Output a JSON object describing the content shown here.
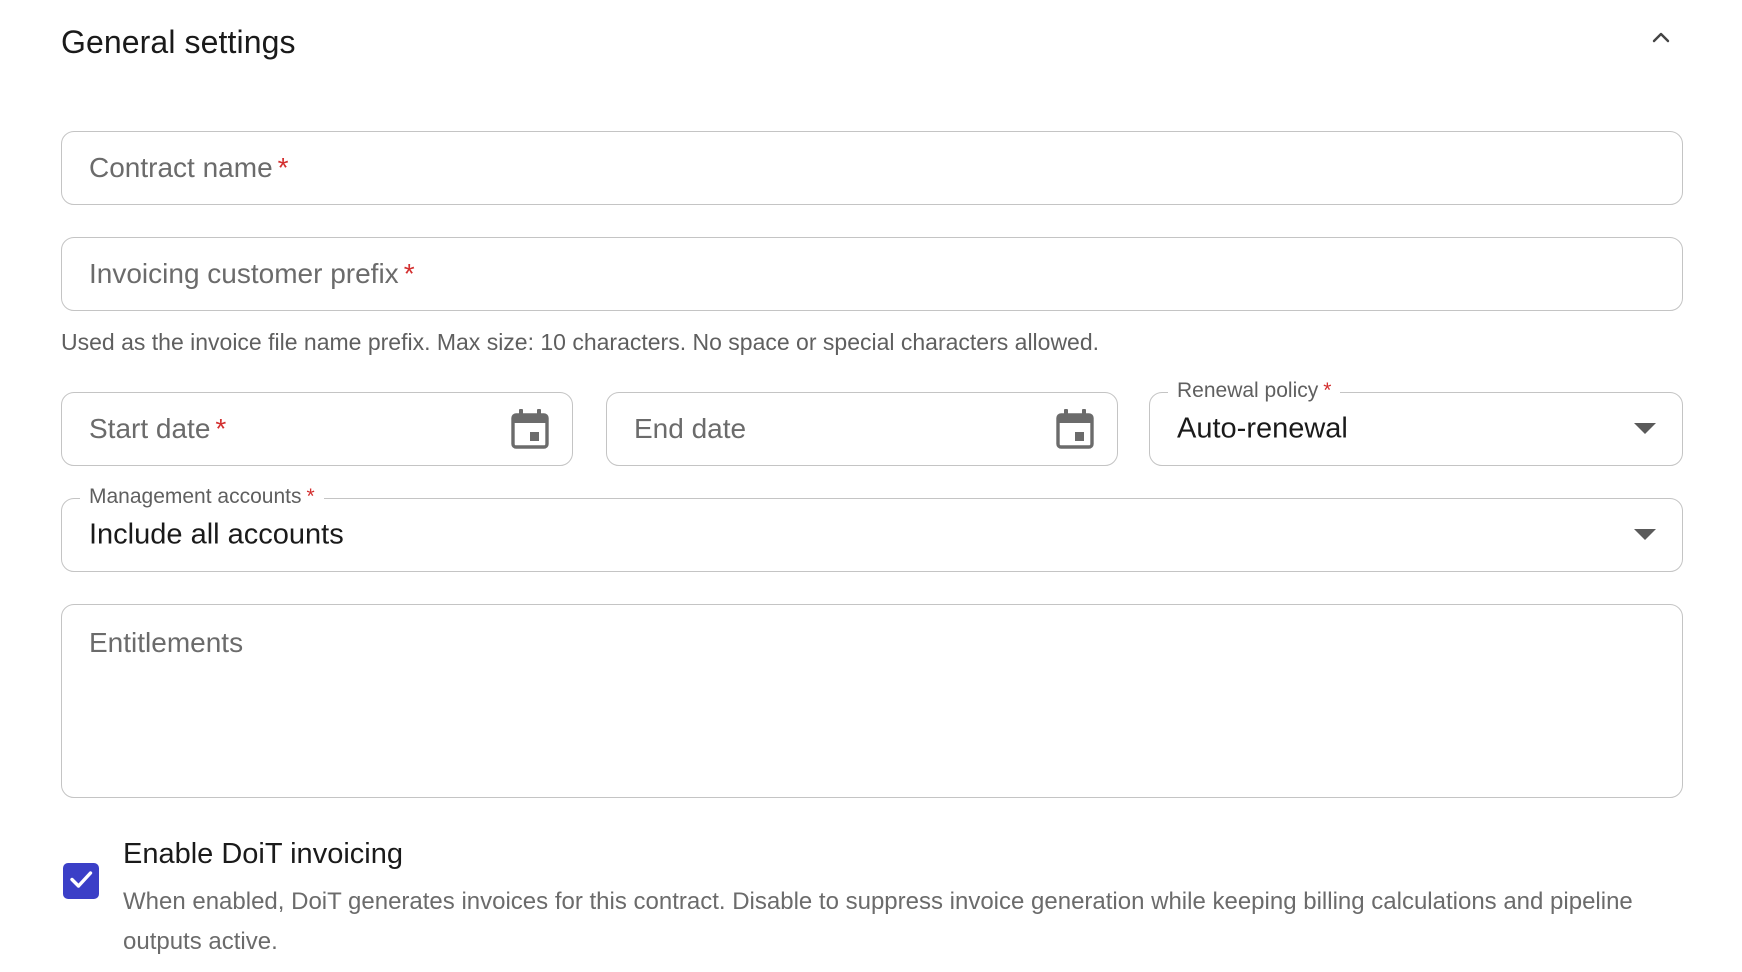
{
  "section": {
    "title": "General settings",
    "collapse_icon": "chevron-up-icon"
  },
  "fields": {
    "contract_name": {
      "placeholder": "Contract name",
      "required_mark": "*"
    },
    "invoicing_prefix": {
      "placeholder": "Invoicing customer prefix",
      "required_mark": "*",
      "helper": "Used as the invoice file name prefix. Max size: 10 characters. No space or special characters allowed."
    },
    "start_date": {
      "placeholder": "Start date",
      "required_mark": "*",
      "icon": "calendar-icon"
    },
    "end_date": {
      "placeholder": "End date",
      "icon": "calendar-icon"
    },
    "renewal_policy": {
      "label": "Renewal policy",
      "required_mark": "*",
      "value": "Auto-renewal",
      "icon": "dropdown-arrow-icon"
    },
    "management_accounts": {
      "label": "Management accounts",
      "required_mark": "*",
      "value": "Include all accounts",
      "icon": "dropdown-arrow-icon"
    },
    "entitlements": {
      "placeholder": "Entitlements"
    }
  },
  "invoicing_checkbox": {
    "checked": true,
    "label": "Enable DoiT invoicing",
    "description": "When enabled, DoiT generates invoices for this contract. Disable to suppress invoice generation while keeping billing calculations and pipeline outputs active."
  },
  "colors": {
    "accent": "#3b3fc7",
    "required": "#d32f2f",
    "border": "#c4c4c4"
  }
}
